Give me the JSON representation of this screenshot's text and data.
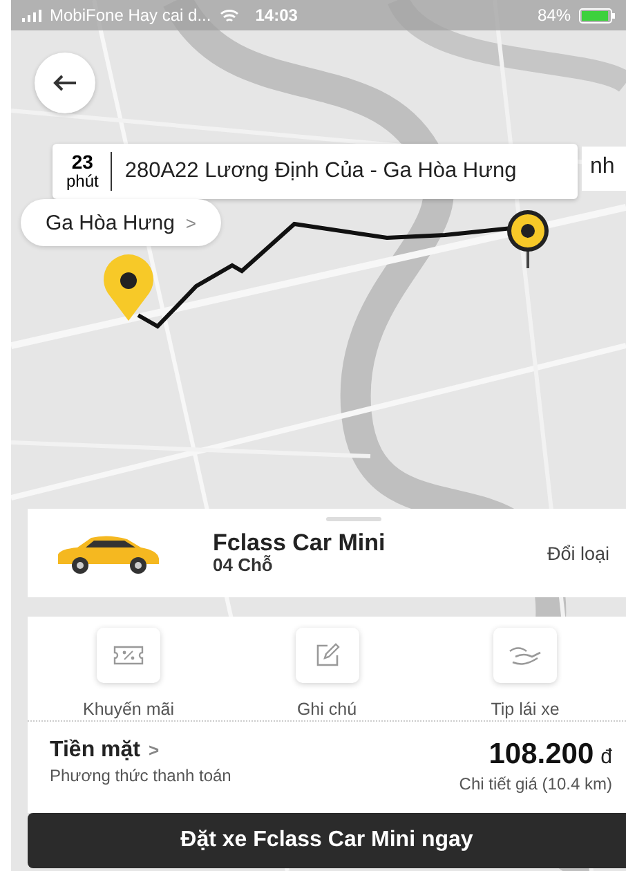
{
  "status_bar": {
    "carrier": "MobiFone Hay cai d...",
    "time": "14:03",
    "battery": "84%"
  },
  "map": {
    "trip_callout": {
      "minutes": "23",
      "unit": "phút",
      "address": "280A22 Lương Định Của - Ga Hòa Hưng"
    },
    "hidden_callout": "nh",
    "pickup_label": {
      "text": "Ga Hòa Hưng",
      "chevron": ">"
    }
  },
  "vehicle": {
    "name": "Fclass Car Mini",
    "seats": "04 Chỗ",
    "change": "Đổi loại"
  },
  "options": [
    {
      "kind": "promo",
      "label": "Khuyến mãi"
    },
    {
      "kind": "note",
      "label": "Ghi chú"
    },
    {
      "kind": "tip",
      "label": "Tip lái xe"
    }
  ],
  "payment": {
    "method": "Tiền mặt",
    "chevron": ">",
    "caption": "Phương thức thanh toán",
    "price": "108.200",
    "currency": "đ",
    "detail": "Chi tiết giá (10.4 km)"
  },
  "book_button": "Đặt xe Fclass Car Mini ngay"
}
